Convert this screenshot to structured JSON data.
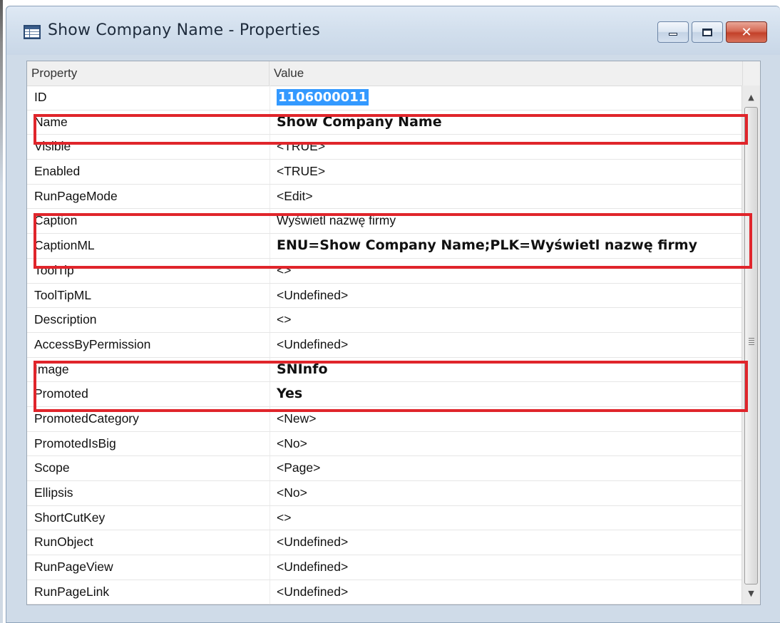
{
  "window": {
    "title": "Show Company Name - Properties",
    "icon": "table-icon",
    "controls": {
      "minimize": "minimize-icon",
      "maximize": "maximize-icon",
      "close": "✕"
    }
  },
  "grid": {
    "columns": {
      "property": "Property",
      "value": "Value"
    },
    "rows": [
      {
        "property": "ID",
        "value": "1106000011",
        "style": "selected"
      },
      {
        "property": "Name",
        "value": "Show Company Name",
        "style": "bold"
      },
      {
        "property": "Visible",
        "value": "<TRUE>",
        "style": "normal"
      },
      {
        "property": "Enabled",
        "value": "<TRUE>",
        "style": "normal"
      },
      {
        "property": "RunPageMode",
        "value": "<Edit>",
        "style": "normal"
      },
      {
        "property": "Caption",
        "value": "Wyświetl nazwę firmy",
        "style": "normal"
      },
      {
        "property": "CaptionML",
        "value": "ENU=Show Company Name;PLK=Wyświetl nazwę firmy",
        "style": "bold"
      },
      {
        "property": "ToolTip",
        "value": "<>",
        "style": "normal"
      },
      {
        "property": "ToolTipML",
        "value": "<Undefined>",
        "style": "normal"
      },
      {
        "property": "Description",
        "value": "<>",
        "style": "normal"
      },
      {
        "property": "AccessByPermission",
        "value": "<Undefined>",
        "style": "normal"
      },
      {
        "property": "Image",
        "value": "SNInfo",
        "style": "bold"
      },
      {
        "property": "Promoted",
        "value": "Yes",
        "style": "bold"
      },
      {
        "property": "PromotedCategory",
        "value": "<New>",
        "style": "normal"
      },
      {
        "property": "PromotedIsBig",
        "value": "<No>",
        "style": "normal"
      },
      {
        "property": "Scope",
        "value": "<Page>",
        "style": "normal"
      },
      {
        "property": "Ellipsis",
        "value": "<No>",
        "style": "normal"
      },
      {
        "property": "ShortCutKey",
        "value": "<>",
        "style": "normal"
      },
      {
        "property": "RunObject",
        "value": "<Undefined>",
        "style": "normal"
      },
      {
        "property": "RunPageView",
        "value": "<Undefined>",
        "style": "normal"
      },
      {
        "property": "RunPageLink",
        "value": "<Undefined>",
        "style": "normal"
      }
    ]
  },
  "colors": {
    "highlight_box": "#e0252b",
    "selection": "#3399ff"
  }
}
